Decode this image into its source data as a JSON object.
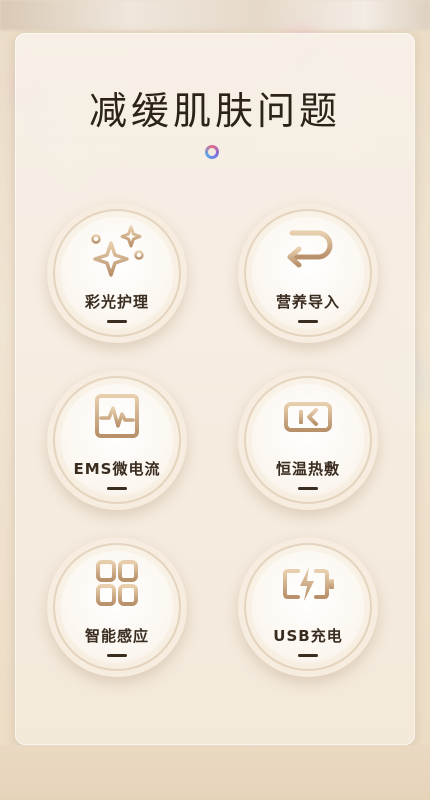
{
  "page": {
    "title": "减缓肌肤问题"
  },
  "features": [
    {
      "label": "彩光护理",
      "icon": "sparkle-icon"
    },
    {
      "label": "营养导入",
      "icon": "return-arrow-icon"
    },
    {
      "label": "EMS微电流",
      "icon": "pulse-wave-icon"
    },
    {
      "label": "恒温热敷",
      "icon": "thermal-temperature-icon"
    },
    {
      "label": "智能感应",
      "icon": "grid-apps-icon"
    },
    {
      "label": "USB充电",
      "icon": "battery-charging-icon"
    }
  ],
  "colors": {
    "icon_gold": "#c9a47a",
    "icon_gold_dark": "#a9815a",
    "text_dark": "#2b2218",
    "panel_bg": "#f4ebde"
  }
}
